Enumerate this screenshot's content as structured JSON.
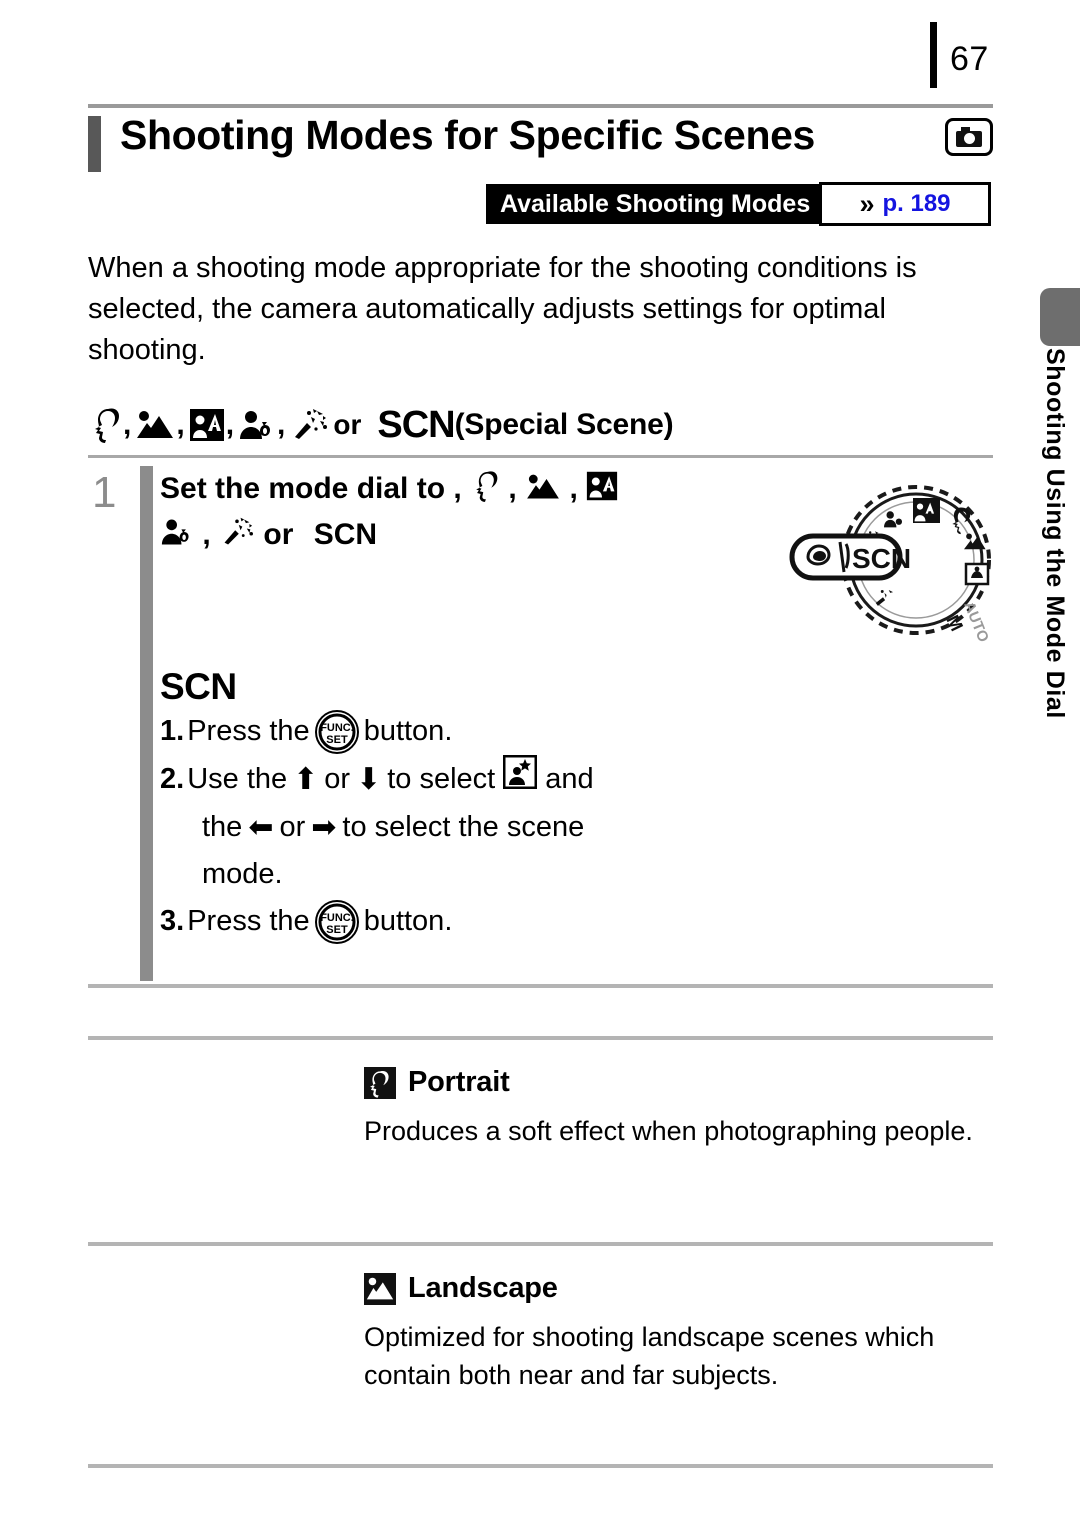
{
  "page": {
    "number": "67",
    "side_tab_label": "Shooting Using the Mode Dial"
  },
  "header": {
    "title": "Shooting Modes for Specific Scenes",
    "camera_icon": "camera-icon"
  },
  "available_modes": {
    "badge_label": "Available Shooting Modes",
    "chevron": "»",
    "page_ref": "p. 189"
  },
  "intro": {
    "text": "When a shooting mode appropriate for the shooting conditions is selected, the camera automatically adjusts settings for optimal shooting."
  },
  "mode_heading": {
    "icons": [
      "portrait-icon",
      "landscape-icon",
      "night-snapshot-icon",
      "kids-and-pets-icon",
      "indoor-icon"
    ],
    "separator": ",",
    "or_label": "or",
    "scn_label": "SCN",
    "paren_label": "(Special Scene)"
  },
  "step": {
    "number": "1",
    "instruction_line1": "Set the mode dial to",
    "instruction_line2_or": "or",
    "instruction_scn": "SCN",
    "comma": ",",
    "scn_section_label": "SCN",
    "substeps": [
      {
        "num": "1.",
        "prefix": "Press the",
        "button": "FUNC./SET",
        "suffix": "button."
      },
      {
        "num": "2.",
        "prefix": "Use the",
        "up": "⬆",
        "or": "or",
        "down": "⬇",
        "mid": "to select",
        "icon": "special-scene-icon",
        "suffix": "and",
        "line2_the": "the",
        "left": "⬅",
        "line2_or": "or",
        "right": "➡",
        "line2_rest": "to select the scene",
        "line3": "mode."
      },
      {
        "num": "3.",
        "prefix": "Press the",
        "button": "FUNC./SET",
        "suffix": "button."
      }
    ],
    "dial": {
      "callout_scn": "SCN",
      "auto_label": "AUTO",
      "m_label": "M"
    }
  },
  "scenes": [
    {
      "icon": "portrait-icon",
      "title": "Portrait",
      "description": "Produces a soft effect when photographing people."
    },
    {
      "icon": "landscape-icon",
      "title": "Landscape",
      "description": "Optimized for shooting landscape scenes which contain both near and far subjects."
    }
  ],
  "colors": {
    "accent_blue": "#1414e0",
    "gray_bar": "#8c8c8c",
    "rule_gray": "#b4b4b4",
    "tab_gray": "#6e6e6e"
  }
}
